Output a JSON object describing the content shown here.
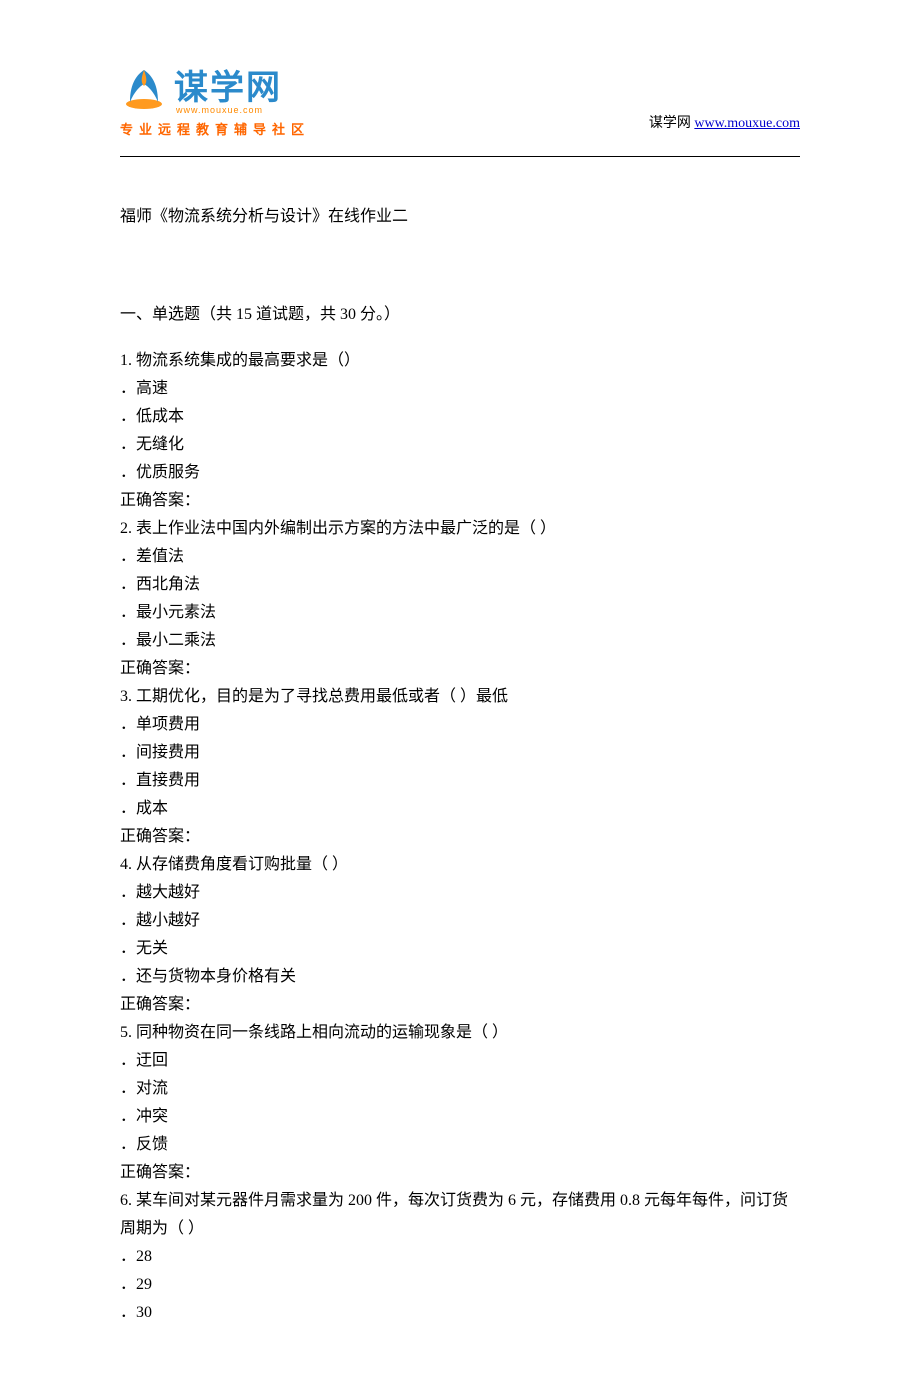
{
  "header": {
    "logo_main": "谋学网",
    "logo_domain": "www.mouxue.com",
    "logo_tagline": "专业远程教育辅导社区",
    "brand_text": "谋学网",
    "url_text": "www.mouxue.com"
  },
  "document": {
    "title": "福师《物流系统分析与设计》在线作业二",
    "section1_header": "一、单选题（共 15 道试题，共 30 分。）",
    "questions": [
      {
        "num": "1.",
        "text": "  物流系统集成的最高要求是（）",
        "options": [
          "．高速",
          "．低成本",
          "．无缝化",
          "．优质服务"
        ],
        "answer_label": "正确答案："
      },
      {
        "num": "2.",
        "text": "  表上作业法中国内外编制出示方案的方法中最广泛的是（ ）",
        "options": [
          "．差值法",
          "．西北角法",
          "．最小元素法",
          "．最小二乘法"
        ],
        "answer_label": "正确答案："
      },
      {
        "num": "3.",
        "text": "  工期优化，目的是为了寻找总费用最低或者（ ）最低",
        "options": [
          "．单项费用",
          "．间接费用",
          "．直接费用",
          "．成本"
        ],
        "answer_label": "正确答案："
      },
      {
        "num": "4.",
        "text": "  从存储费角度看订购批量（ ）",
        "options": [
          "．越大越好",
          "．越小越好",
          "．无关",
          "．还与货物本身价格有关"
        ],
        "answer_label": "正确答案："
      },
      {
        "num": "5.",
        "text": "  同种物资在同一条线路上相向流动的运输现象是（ ）",
        "options": [
          "．迂回",
          "．对流",
          "．冲突",
          "．反馈"
        ],
        "answer_label": "正确答案："
      },
      {
        "num": "6.",
        "text": "  某车间对某元器件月需求量为 200 件，每次订货费为 6 元，存储费用 0.8 元每年每件，问订货周期为（ ）",
        "options": [
          "．28",
          "．29",
          "．30"
        ],
        "answer_label": ""
      }
    ]
  }
}
